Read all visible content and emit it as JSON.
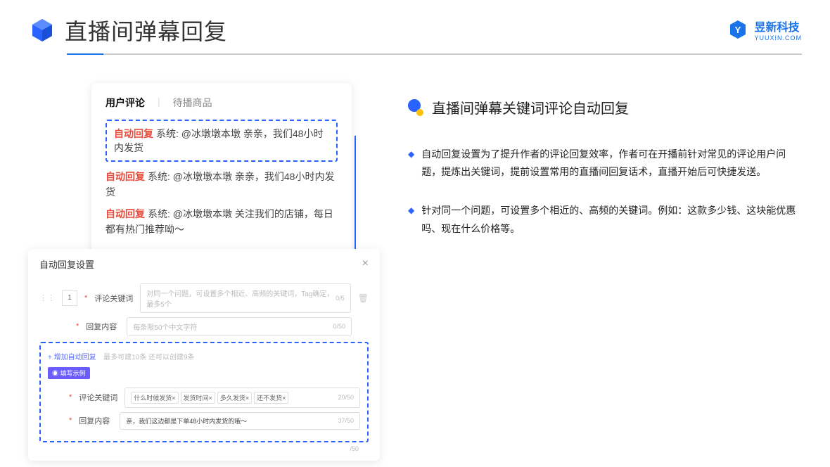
{
  "header": {
    "title": "直播间弹幕回复"
  },
  "brand": {
    "cn": "昱新科技",
    "en": "YUUXIN.COM"
  },
  "panel_top": {
    "tab_active": "用户评论",
    "tab_inactive": "待播商品",
    "sep": "|",
    "highlighted": "系统: @冰墩墩本墩 亲亲，我们48小时内发货",
    "line2": "系统: @冰墩墩本墩 亲亲，我们48小时内发货",
    "line3": "系统: @冰墩墩本墩 关注我们的店铺，每日都有热门推荐呦～",
    "tag": "自动回复"
  },
  "panel_bottom": {
    "title": "自动回复设置",
    "close": "×",
    "num": "1",
    "row1_label": "评论关键词",
    "row1_ph": "对同一个问题，可设置多个相近、高频的关键词，Tag确定，最多5个",
    "row1_count": "0/5",
    "row2_label": "回复内容",
    "row2_ph": "每条限50个中文字符",
    "row2_count": "0/50",
    "trash": "🗑",
    "add": "+ 增加自动回复",
    "hint": "最多可建10条 还可以创建9条",
    "badge": "◉ 填写示例",
    "ex1_label": "评论关键词",
    "ex1_tags": [
      "什么时候发货×",
      "发货时间×",
      "多久发货×",
      "还不发货×"
    ],
    "ex1_count": "20/50",
    "ex2_label": "回复内容",
    "ex2_val": "亲，我们这边都是下单48小时内发货的哦～",
    "ex2_count": "37/50",
    "ex_outer_count": "/50"
  },
  "right": {
    "subtitle": "直播间弹幕关键词评论自动回复",
    "b1": "自动回复设置为了提升作者的评论回复效率，作者可在开播前针对常见的评论用户问题，提炼出关键词，提前设置常用的直播间回复话术，直播开始后可快捷发送。",
    "b2": "针对同一个问题，可设置多个相近的、高频的关键词。例如：这款多少钱、这块能优惠吗、现在什么价格等。"
  }
}
